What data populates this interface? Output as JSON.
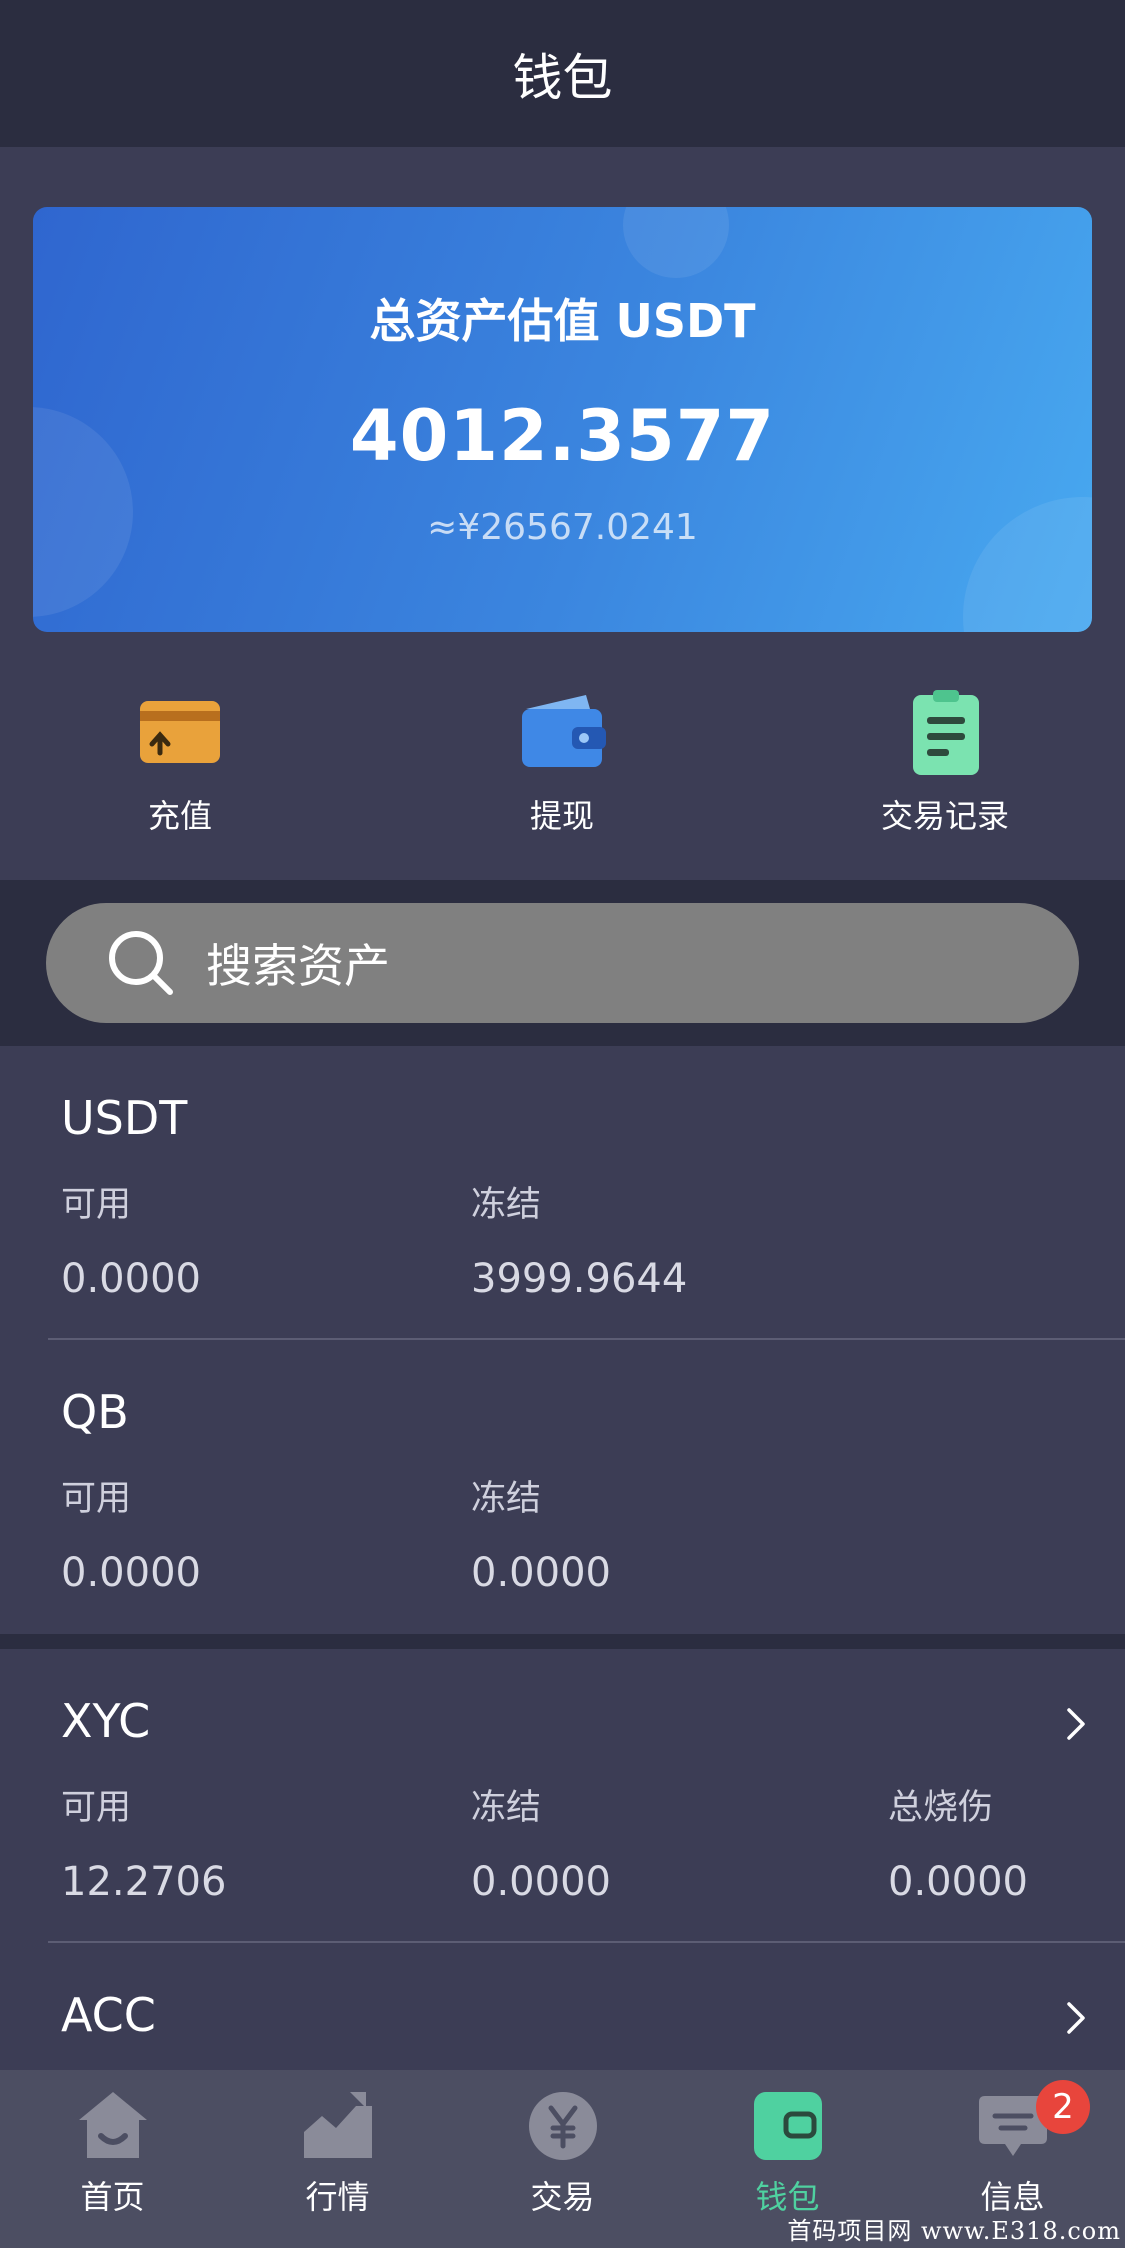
{
  "header": {
    "title": "钱包"
  },
  "summary": {
    "title": "总资产估值 USDT",
    "total": "4012.3577",
    "cny": "≈¥26567.0241"
  },
  "actions": [
    {
      "label": "充值",
      "icon": "recharge-card-icon"
    },
    {
      "label": "提现",
      "icon": "wallet-icon"
    },
    {
      "label": "交易记录",
      "icon": "clipboard-icon"
    }
  ],
  "search": {
    "placeholder": "搜索资产"
  },
  "assets": [
    {
      "name": "USDT",
      "available_label": "可用",
      "available": "0.0000",
      "frozen_label": "冻结",
      "frozen": "3999.9644"
    },
    {
      "name": "QB",
      "available_label": "可用",
      "available": "0.0000",
      "frozen_label": "冻结",
      "frozen": "0.0000"
    },
    {
      "name": "XYC",
      "available_label": "可用",
      "available": "12.2706",
      "frozen_label": "冻结",
      "frozen": "0.0000",
      "burn_label": "总烧伤",
      "burn": "0.0000"
    },
    {
      "name": "ACC"
    }
  ],
  "tabs": [
    {
      "label": "首页",
      "icon": "home-icon"
    },
    {
      "label": "行情",
      "icon": "market-chart-icon"
    },
    {
      "label": "交易",
      "icon": "yen-coin-icon"
    },
    {
      "label": "钱包",
      "icon": "wallet-tab-icon",
      "active": true
    },
    {
      "label": "信息",
      "icon": "message-icon",
      "badge": "2"
    }
  ],
  "colors": {
    "accent": "#4fd1a0",
    "card_start": "#2f66cf",
    "card_end": "#48a9f0",
    "badge": "#e8453c"
  },
  "watermark": "首码项目网 www.E318.com"
}
